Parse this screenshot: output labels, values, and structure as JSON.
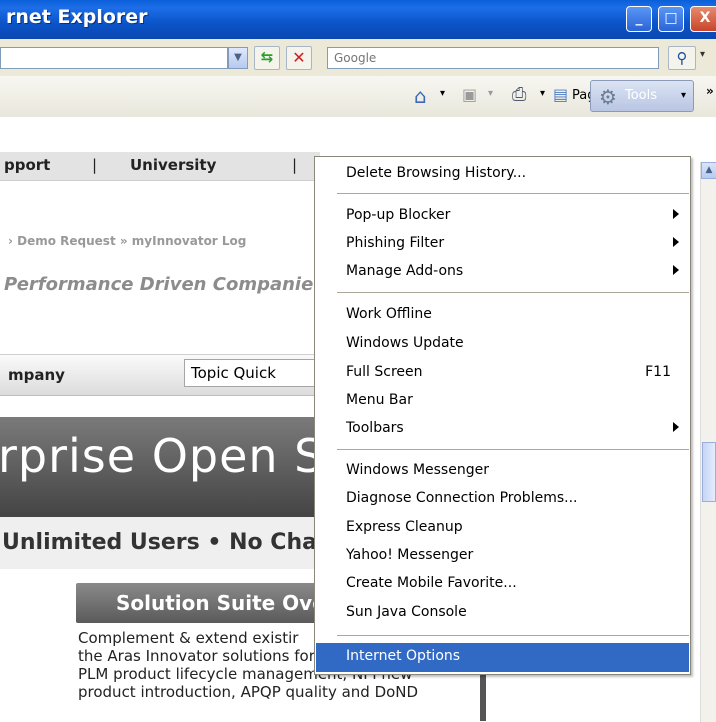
{
  "window": {
    "title": "rnet Explorer",
    "controls": {
      "minimize": "_",
      "maximize": "□",
      "close": "X"
    }
  },
  "address_bar": {
    "search_placeholder": "Google",
    "go_icon": "refresh-arrows-icon",
    "stop_icon": "stop-x-icon",
    "search_icon": "magnifier-icon"
  },
  "command_bar": {
    "home_icon": "home-icon",
    "feeds_icon": "feeds-icon",
    "print_icon": "printer-icon",
    "page_label": "Page",
    "tools_label": "Tools"
  },
  "page": {
    "nav_items": [
      "pport",
      "|",
      "University",
      "|"
    ],
    "breadcrumbs": "› Demo Request  » myInnovator Log",
    "tagline": "Performance Driven Companie",
    "company_label": "mpany",
    "topic_field": "Topic Quick",
    "hero_text": "rprise Open S",
    "sub_text": "Unlimited Users • No Cha",
    "suite_header": "Solution Suite Over",
    "body_lines": [
      "Complement & extend existir",
      "the Aras Innovator solutions for enterprise",
      "PLM product lifecycle management, NPI new",
      "product introduction, APQP quality and DoND"
    ]
  },
  "tools_menu": {
    "items": [
      {
        "label": "Delete Browsing History...",
        "submenu": false
      },
      {
        "label": "Pop-up Blocker",
        "submenu": true
      },
      {
        "label": "Phishing Filter",
        "submenu": true
      },
      {
        "label": "Manage Add-ons",
        "submenu": true
      },
      {
        "label": "Work Offline",
        "submenu": false
      },
      {
        "label": "Windows Update",
        "submenu": false
      },
      {
        "label": "Full Screen",
        "submenu": false,
        "shortcut": "F11"
      },
      {
        "label": "Menu Bar",
        "submenu": false
      },
      {
        "label": "Toolbars",
        "submenu": true
      },
      {
        "label": "Windows Messenger",
        "submenu": false
      },
      {
        "label": "Diagnose Connection Problems...",
        "submenu": false
      },
      {
        "label": "Express Cleanup",
        "submenu": false
      },
      {
        "label": "Yahoo! Messenger",
        "submenu": false
      },
      {
        "label": "Create Mobile Favorite...",
        "submenu": false
      },
      {
        "label": "Sun Java Console",
        "submenu": false
      },
      {
        "label": "Internet Options",
        "submenu": false,
        "highlighted": true
      }
    ]
  },
  "colors": {
    "title_bar": "#0a5fd8",
    "menu_highlight": "#316ac5",
    "chrome": "#ece9d8"
  }
}
